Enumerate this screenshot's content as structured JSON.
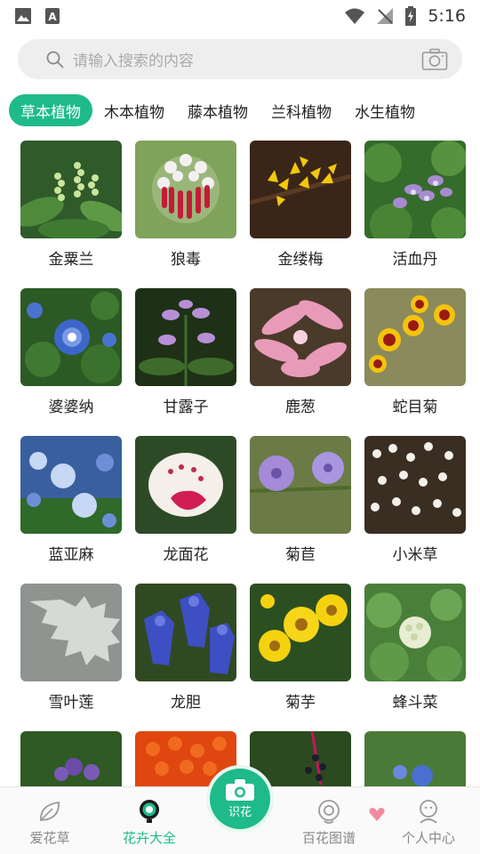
{
  "status_bar": {
    "time": "5:16"
  },
  "search": {
    "placeholder": "请输入搜索的内容"
  },
  "tabs": [
    {
      "label": "草本植物",
      "active": true
    },
    {
      "label": "木本植物",
      "active": false
    },
    {
      "label": "藤本植物",
      "active": false
    },
    {
      "label": "兰科植物",
      "active": false
    },
    {
      "label": "水生植物",
      "active": false
    }
  ],
  "plants": [
    {
      "name": "金粟兰"
    },
    {
      "name": "狼毒"
    },
    {
      "name": "金缕梅"
    },
    {
      "name": "活血丹"
    },
    {
      "name": "婆婆纳"
    },
    {
      "name": "甘露子"
    },
    {
      "name": "鹿葱"
    },
    {
      "name": "蛇目菊"
    },
    {
      "name": "蓝亚麻"
    },
    {
      "name": "龙面花"
    },
    {
      "name": "菊苣"
    },
    {
      "name": "小米草"
    },
    {
      "name": "雪叶莲"
    },
    {
      "name": "龙胆"
    },
    {
      "name": "菊芋"
    },
    {
      "name": "蜂斗菜"
    },
    {
      "name": ""
    },
    {
      "name": ""
    },
    {
      "name": ""
    },
    {
      "name": ""
    }
  ],
  "bottom_nav": {
    "items": [
      {
        "label": "爱花草",
        "icon": "leaf-icon"
      },
      {
        "label": "花卉大全",
        "icon": "flower-catalog-icon",
        "active": true
      },
      {
        "label": "百花图谱",
        "icon": "atlas-icon"
      },
      {
        "label": "个人中心",
        "icon": "profile-icon"
      }
    ],
    "scan_label": "识花"
  },
  "colors": {
    "accent": "#1fba8a"
  }
}
